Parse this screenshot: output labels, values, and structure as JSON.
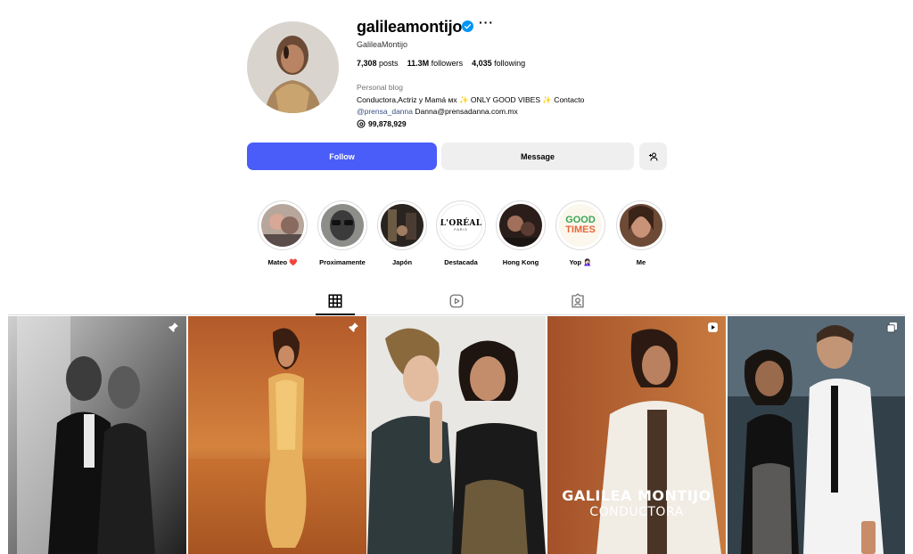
{
  "profile": {
    "username": "galileamontijo",
    "full_name": "GalileaMontijo",
    "more_label": "···",
    "stats": {
      "posts_count": "7,308",
      "posts_label": "posts",
      "followers_count": "11.3M",
      "followers_label": "followers",
      "following_count": "4,035",
      "following_label": "following"
    },
    "category": "Personal blog",
    "bio_line1": "Conductora,Actriz y Mamá ᴍx ✨ ONLY GOOD VIBES ✨  Contacto",
    "bio_mention": "@prensa_danna",
    "bio_email": " Danna@prensadanna.com.mx",
    "threads_count": "99,878,929",
    "verified_color": "#0095f6"
  },
  "actions": {
    "follow_label": "Follow",
    "message_label": "Message"
  },
  "highlights": [
    {
      "label": "Mateo ❤️"
    },
    {
      "label": "Proximamente"
    },
    {
      "label": "Japón"
    },
    {
      "label": "Destacada",
      "logo_text": "L'ORÉAL",
      "logo_sub": "PARIS"
    },
    {
      "label": "Hong Kong"
    },
    {
      "label": "Yop 🤦🏻‍♀️",
      "logo_line1": "GOOD",
      "logo_line2": "TIMES"
    },
    {
      "label": "Me"
    }
  ],
  "tabs": [
    "posts-grid",
    "reels",
    "tagged"
  ],
  "posts": [
    {
      "badge": "pin-icon"
    },
    {
      "badge": "pin-icon"
    },
    {
      "badge": "none"
    },
    {
      "badge": "reel-icon",
      "overlay_line1": "GALILEA MONTIJO",
      "overlay_line2": "CONDUCTORA"
    },
    {
      "badge": "carousel-icon"
    }
  ],
  "colors": {
    "accent": "#4a5df9",
    "button_secondary": "#efefef",
    "link": "#385185"
  }
}
